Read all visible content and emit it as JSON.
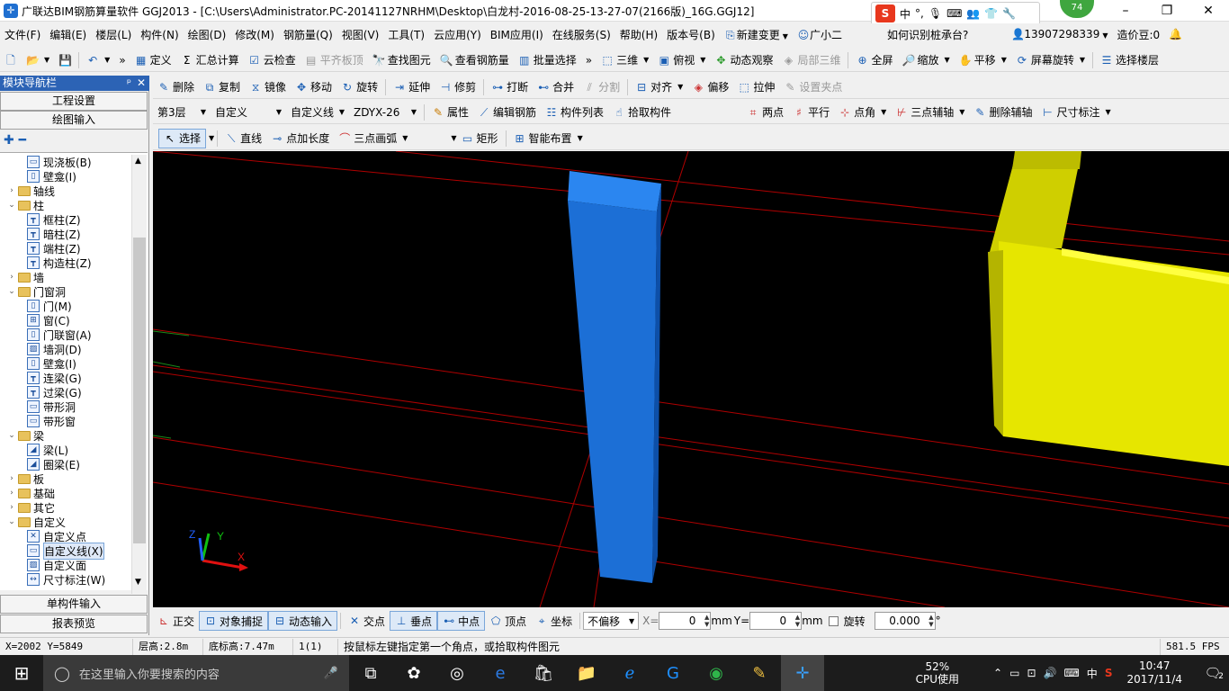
{
  "window": {
    "title": "广联达BIM钢筋算量软件 GGJ2013 - [C:\\Users\\Administrator.PC-20141127NRHM\\Desktop\\白龙村-2016-08-25-13-27-07(2166版)_16G.GGJ12]",
    "minimize": "–",
    "maximize": "❐",
    "close": "✕",
    "badge": "74"
  },
  "ime": {
    "logo": "S",
    "mode": "中",
    "punct": "°,"
  },
  "menu": [
    "文件(F)",
    "编辑(E)",
    "楼层(L)",
    "构件(N)",
    "绘图(D)",
    "修改(M)",
    "钢筋量(Q)",
    "视图(V)",
    "工具(T)",
    "云应用(Y)",
    "BIM应用(I)",
    "在线服务(S)",
    "帮助(H)",
    "版本号(B)",
    "新建变更",
    "广小二",
    "如何识别桩承台?",
    "13907298339",
    "造价豆:0"
  ],
  "toolbar1": {
    "define": "定义",
    "sum": "汇总计算",
    "cloudcheck": "云检查",
    "flatboard": "平齐板顶",
    "findelem": "查找图元",
    "viewrebar": "查看钢筋量",
    "batchselect": "批量选择",
    "view3d": "三维",
    "topview": "俯视",
    "dynamic": "动态观察",
    "local3d": "局部三维",
    "fullscreen": "全屏",
    "zoom": "缩放",
    "pan": "平移",
    "rotate": "屏幕旋转",
    "selectfloor": "选择楼层"
  },
  "toolbar2": {
    "delete": "删除",
    "copy": "复制",
    "mirror": "镜像",
    "move": "移动",
    "rotate": "旋转",
    "extend": "延伸",
    "trim": "修剪",
    "break": "打断",
    "merge": "合并",
    "split": "分割",
    "align": "对齐",
    "offset": "偏移",
    "stretch": "拉伸",
    "setpoint": "设置夹点"
  },
  "toolbar3": {
    "floor": "第3层",
    "type": "自定义",
    "subtype": "自定义线",
    "name": "ZDYX-26",
    "props": "属性",
    "editrebar": "编辑钢筋",
    "elemlist": "构件列表",
    "pick": "拾取构件",
    "twopoint": "两点",
    "parallel": "平行",
    "pointangle": "点角",
    "threeaxis": "三点辅轴",
    "delaxis": "删除辅轴",
    "dim": "尺寸标注"
  },
  "toolbar4": {
    "select": "选择",
    "line": "直线",
    "pointlen": "点加长度",
    "arc": "三点画弧",
    "rect": "矩形",
    "smart": "智能布置"
  },
  "leftpanel": {
    "title": "模块导航栏",
    "pin": "ᵖ",
    "close": "✕",
    "btn1": "工程设置",
    "btn2": "绘图输入",
    "btn3": "单构件输入",
    "btn4": "报表预览",
    "tree": [
      {
        "label": "现浇板(B)",
        "level": 2,
        "kind": "leaf",
        "icon": "▭"
      },
      {
        "label": "壁龛(I)",
        "level": 2,
        "kind": "leaf",
        "icon": "▯"
      },
      {
        "label": "轴线",
        "level": 1,
        "kind": "folder",
        "exp": "›"
      },
      {
        "label": "柱",
        "level": 1,
        "kind": "folder",
        "exp": "⌄"
      },
      {
        "label": "框柱(Z)",
        "level": 2,
        "kind": "leaf",
        "icon": "┳"
      },
      {
        "label": "暗柱(Z)",
        "level": 2,
        "kind": "leaf",
        "icon": "┳"
      },
      {
        "label": "端柱(Z)",
        "level": 2,
        "kind": "leaf",
        "icon": "┳"
      },
      {
        "label": "构造柱(Z)",
        "level": 2,
        "kind": "leaf",
        "icon": "┳"
      },
      {
        "label": "墙",
        "level": 1,
        "kind": "folder",
        "exp": "›"
      },
      {
        "label": "门窗洞",
        "level": 1,
        "kind": "folder",
        "exp": "⌄"
      },
      {
        "label": "门(M)",
        "level": 2,
        "kind": "leaf",
        "icon": "▯"
      },
      {
        "label": "窗(C)",
        "level": 2,
        "kind": "leaf",
        "icon": "⊞"
      },
      {
        "label": "门联窗(A)",
        "level": 2,
        "kind": "leaf",
        "icon": "▯"
      },
      {
        "label": "墙洞(D)",
        "level": 2,
        "kind": "leaf",
        "icon": "▨"
      },
      {
        "label": "壁龛(I)",
        "level": 2,
        "kind": "leaf",
        "icon": "▯"
      },
      {
        "label": "连梁(G)",
        "level": 2,
        "kind": "leaf",
        "icon": "┳"
      },
      {
        "label": "过梁(G)",
        "level": 2,
        "kind": "leaf",
        "icon": "┳"
      },
      {
        "label": "带形洞",
        "level": 2,
        "kind": "leaf",
        "icon": "▭"
      },
      {
        "label": "带形窗",
        "level": 2,
        "kind": "leaf",
        "icon": "▭"
      },
      {
        "label": "梁",
        "level": 1,
        "kind": "folder",
        "exp": "⌄"
      },
      {
        "label": "梁(L)",
        "level": 2,
        "kind": "leaf",
        "icon": "◢"
      },
      {
        "label": "圈梁(E)",
        "level": 2,
        "kind": "leaf",
        "icon": "◢"
      },
      {
        "label": "板",
        "level": 1,
        "kind": "folder",
        "exp": "›"
      },
      {
        "label": "基础",
        "level": 1,
        "kind": "folder",
        "exp": "›"
      },
      {
        "label": "其它",
        "level": 1,
        "kind": "folder",
        "exp": "›"
      },
      {
        "label": "自定义",
        "level": 1,
        "kind": "folder",
        "exp": "⌄"
      },
      {
        "label": "自定义点",
        "level": 2,
        "kind": "leaf",
        "icon": "✕"
      },
      {
        "label": "自定义线(X)",
        "level": 2,
        "kind": "leaf",
        "icon": "▭"
      },
      {
        "label": "自定义面",
        "level": 2,
        "kind": "leaf",
        "icon": "▨"
      },
      {
        "label": "尺寸标注(W)",
        "level": 2,
        "kind": "leaf",
        "icon": "↔"
      }
    ]
  },
  "axes": {
    "x": "X",
    "y": "Y",
    "z": "Z"
  },
  "statusbar": {
    "ortho": "正交",
    "snap": "对象捕捉",
    "dyninput": "动态输入",
    "intersect": "交点",
    "perp": "垂点",
    "mid": "中点",
    "vertex": "顶点",
    "coord": "坐标",
    "offset": "不偏移",
    "xlabel": "X=",
    "xval": "0",
    "unit1": "mm",
    "ylabel": "Y=",
    "yval": "0",
    "unit2": "mm",
    "rotlabel": "旋转",
    "rotval": "0.000",
    "deg": "°"
  },
  "infobar": {
    "coords": "X=2002 Y=5849",
    "floorh": "层高:2.8m",
    "baseh": "底标高:7.47m",
    "count": "1(1)",
    "hint": "按鼠标左键指定第一个角点，或拾取构件图元",
    "fps": "581.5 FPS"
  },
  "taskbar": {
    "search": "在这里输入你要搜索的内容",
    "cpu": "52%",
    "cpulabel": "CPU使用",
    "lang": "中",
    "time": "10:47",
    "date": "2017/11/4",
    "notif": "2"
  },
  "colors": {
    "column": "#1c6fd6",
    "wall": "#e6e600",
    "axisline": "#b00000",
    "accent": "#2c63b5"
  }
}
